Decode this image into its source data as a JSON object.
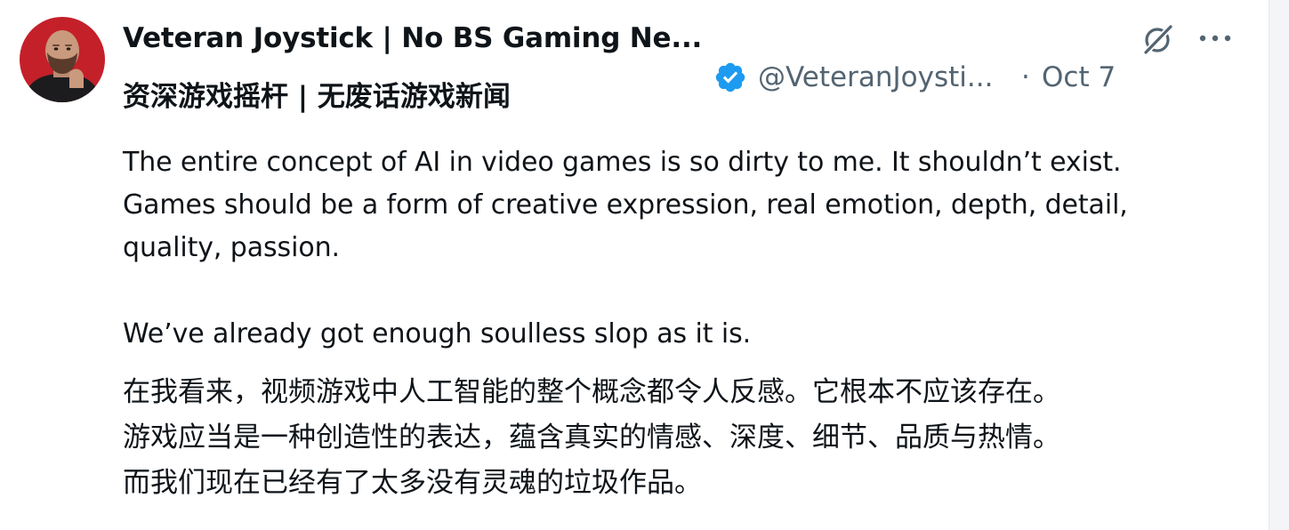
{
  "author": {
    "display_name": "Veteran Joystick | No BS Gaming Ne...",
    "display_name_cn": "资深游戏摇杆 | 无废话游戏新闻",
    "handle": "@VeteranJoysti...",
    "separator": "·",
    "date": "Oct 7",
    "verified": true
  },
  "tweet": {
    "lines_en": [
      "The entire concept of AI in video games is so dirty to me. It shouldn’t exist.",
      "Games should be a form of creative expression, real emotion, depth, detail,",
      "quality, passion.",
      "We’ve already got enough soulless slop as it is."
    ],
    "lines_cn": [
      "在我看来，视频游戏中人工智能的整个概念都令人反感。它根本不应该存在。",
      "游戏应当是一种创造性的表达，蕴含真实的情感、深度、细节、品质与热情。",
      "而我们现在已经有了太多没有灵魂的垃圾作品。"
    ]
  },
  "icons": {
    "verified": "verified-badge-icon",
    "grok": "grok-icon",
    "more": "more-options-icon"
  },
  "colors": {
    "text_primary": "#0f1419",
    "text_secondary": "#536471",
    "verified_blue": "#1d9bf0",
    "avatar_bg": "#c4202a"
  }
}
